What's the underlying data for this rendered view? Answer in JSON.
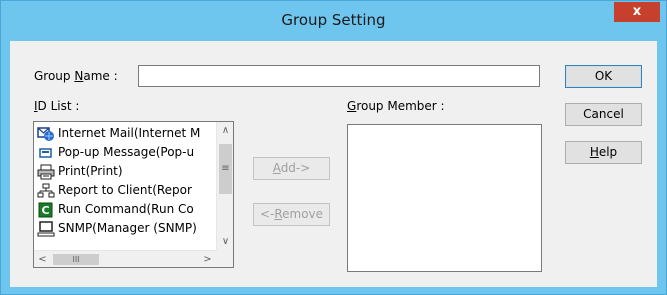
{
  "window": {
    "title": "Group Setting",
    "close_label": "x"
  },
  "group_name": {
    "label_pre": "Group ",
    "label_u": "N",
    "label_post": "ame :",
    "value": ""
  },
  "id_list": {
    "label_u": "I",
    "label_post": "D List :",
    "items": [
      {
        "label": "Internet Mail(Internet M",
        "icon": "internet-mail-icon"
      },
      {
        "label": "Pop-up Message(Pop-u",
        "icon": "popup-message-icon"
      },
      {
        "label": "Print(Print)",
        "icon": "printer-icon"
      },
      {
        "label": "Report to Client(Repor",
        "icon": "network-report-icon"
      },
      {
        "label": "Run Command(Run Co",
        "icon": "run-command-icon"
      },
      {
        "label": "SNMP(Manager (SNMP)",
        "icon": "computer-icon"
      }
    ],
    "scroll_up": "∧",
    "scroll_down": "∨",
    "scroll_left": "<",
    "scroll_right": ">",
    "thumb_grip": "≡",
    "hthumb_grip": "III"
  },
  "group_member": {
    "label_u": "G",
    "label_post": "roup Member :"
  },
  "buttons": {
    "ok": "OK",
    "cancel": "Cancel",
    "help_u": "H",
    "help_post": "elp",
    "add_u": "A",
    "add_post": "dd->",
    "remove_pre": "<-",
    "remove_u": "R",
    "remove_post": "emove"
  }
}
